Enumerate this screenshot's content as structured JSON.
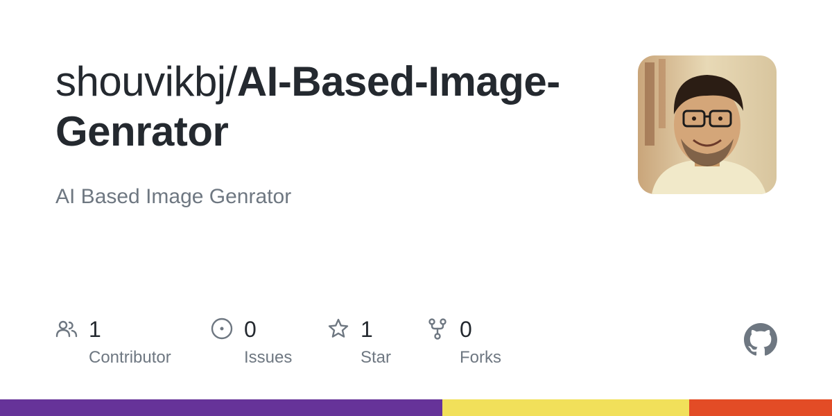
{
  "repo": {
    "owner": "shouvikbj/",
    "name": "AI-Based-Image-Genrator",
    "description": "AI Based Image Genrator"
  },
  "stats": [
    {
      "icon": "people-icon",
      "count": "1",
      "label": "Contributor"
    },
    {
      "icon": "issue-icon",
      "count": "0",
      "label": "Issues"
    },
    {
      "icon": "star-icon",
      "count": "1",
      "label": "Star"
    },
    {
      "icon": "fork-icon",
      "count": "0",
      "label": "Forks"
    }
  ],
  "language_bar": [
    {
      "color": "#663399",
      "share": 0.532
    },
    {
      "color": "#f1e05a",
      "share": 0.296
    },
    {
      "color": "#e34c26",
      "share": 0.172
    }
  ],
  "colors": {
    "text": "#24292f",
    "muted": "#6e7781",
    "icon": "#6e7781"
  }
}
